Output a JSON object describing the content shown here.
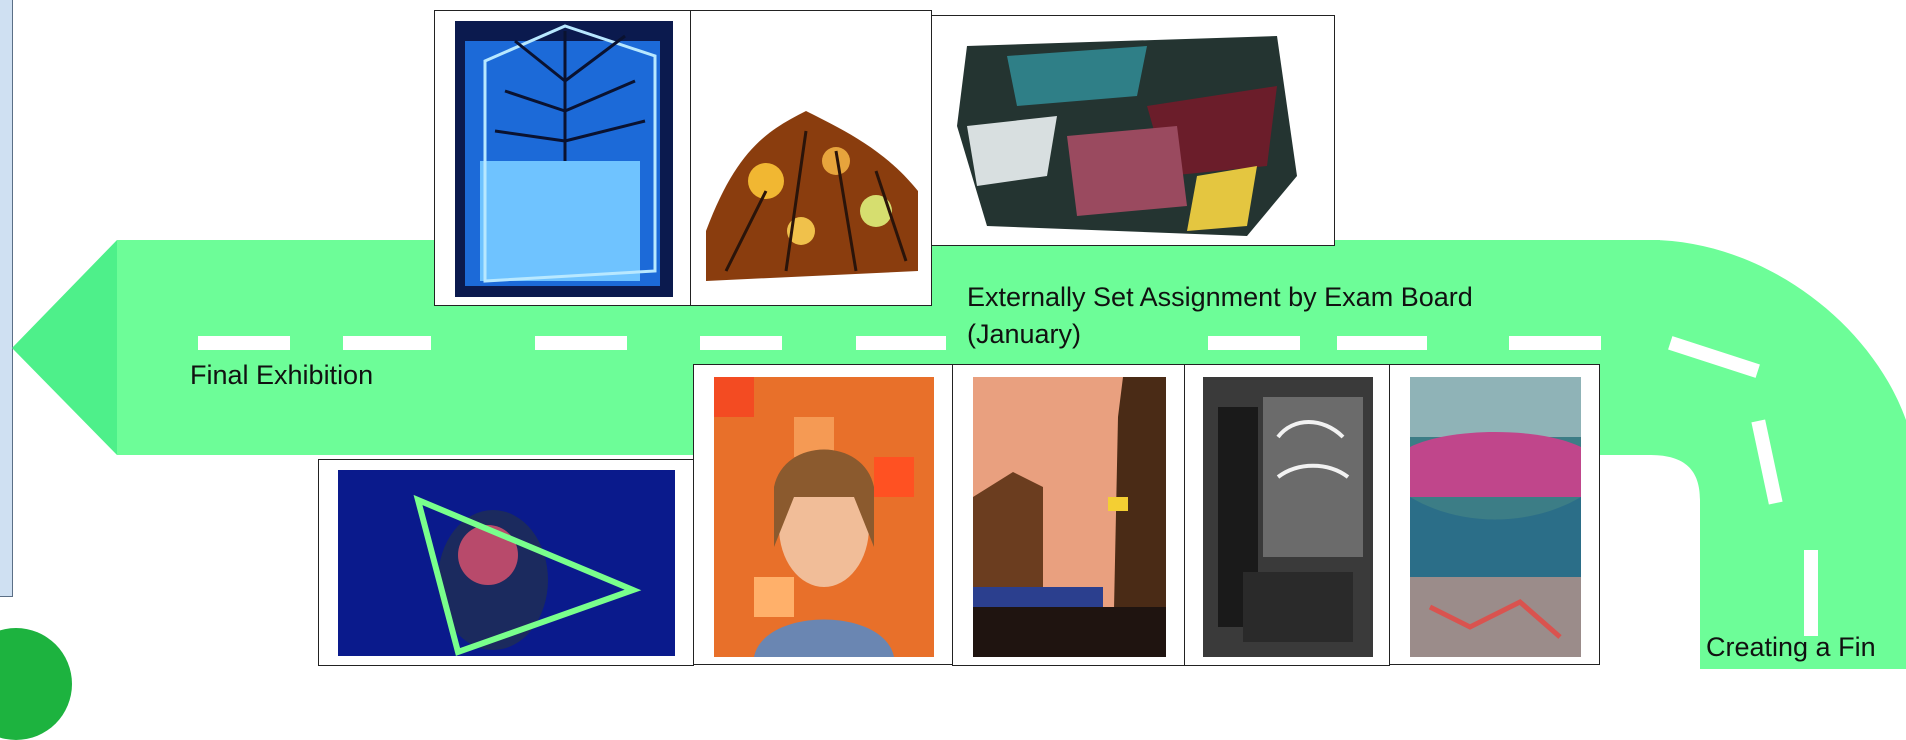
{
  "colors": {
    "road": "#6dfd98",
    "road_tip": "#4ef08a",
    "dash": "#ffffff",
    "panel": "#cfe0f2",
    "circle": "#1db33f"
  },
  "labels": {
    "final_exhibition": "Final Exhibition",
    "externally_set_line1": "Externally Set Assignment by Exam Board",
    "externally_set_line2": "(January)",
    "creating_final": "Creating a Fin"
  },
  "images": [
    "blue-cube-tree-photo",
    "autumn-branches-photo",
    "abstract-collage-photo",
    "neon-triangle-portrait-photo",
    "orange-pixel-portrait-photo",
    "sunset-street-photo",
    "monochrome-neon-shopfront-photo",
    "graffiti-skatepark-photo"
  ]
}
